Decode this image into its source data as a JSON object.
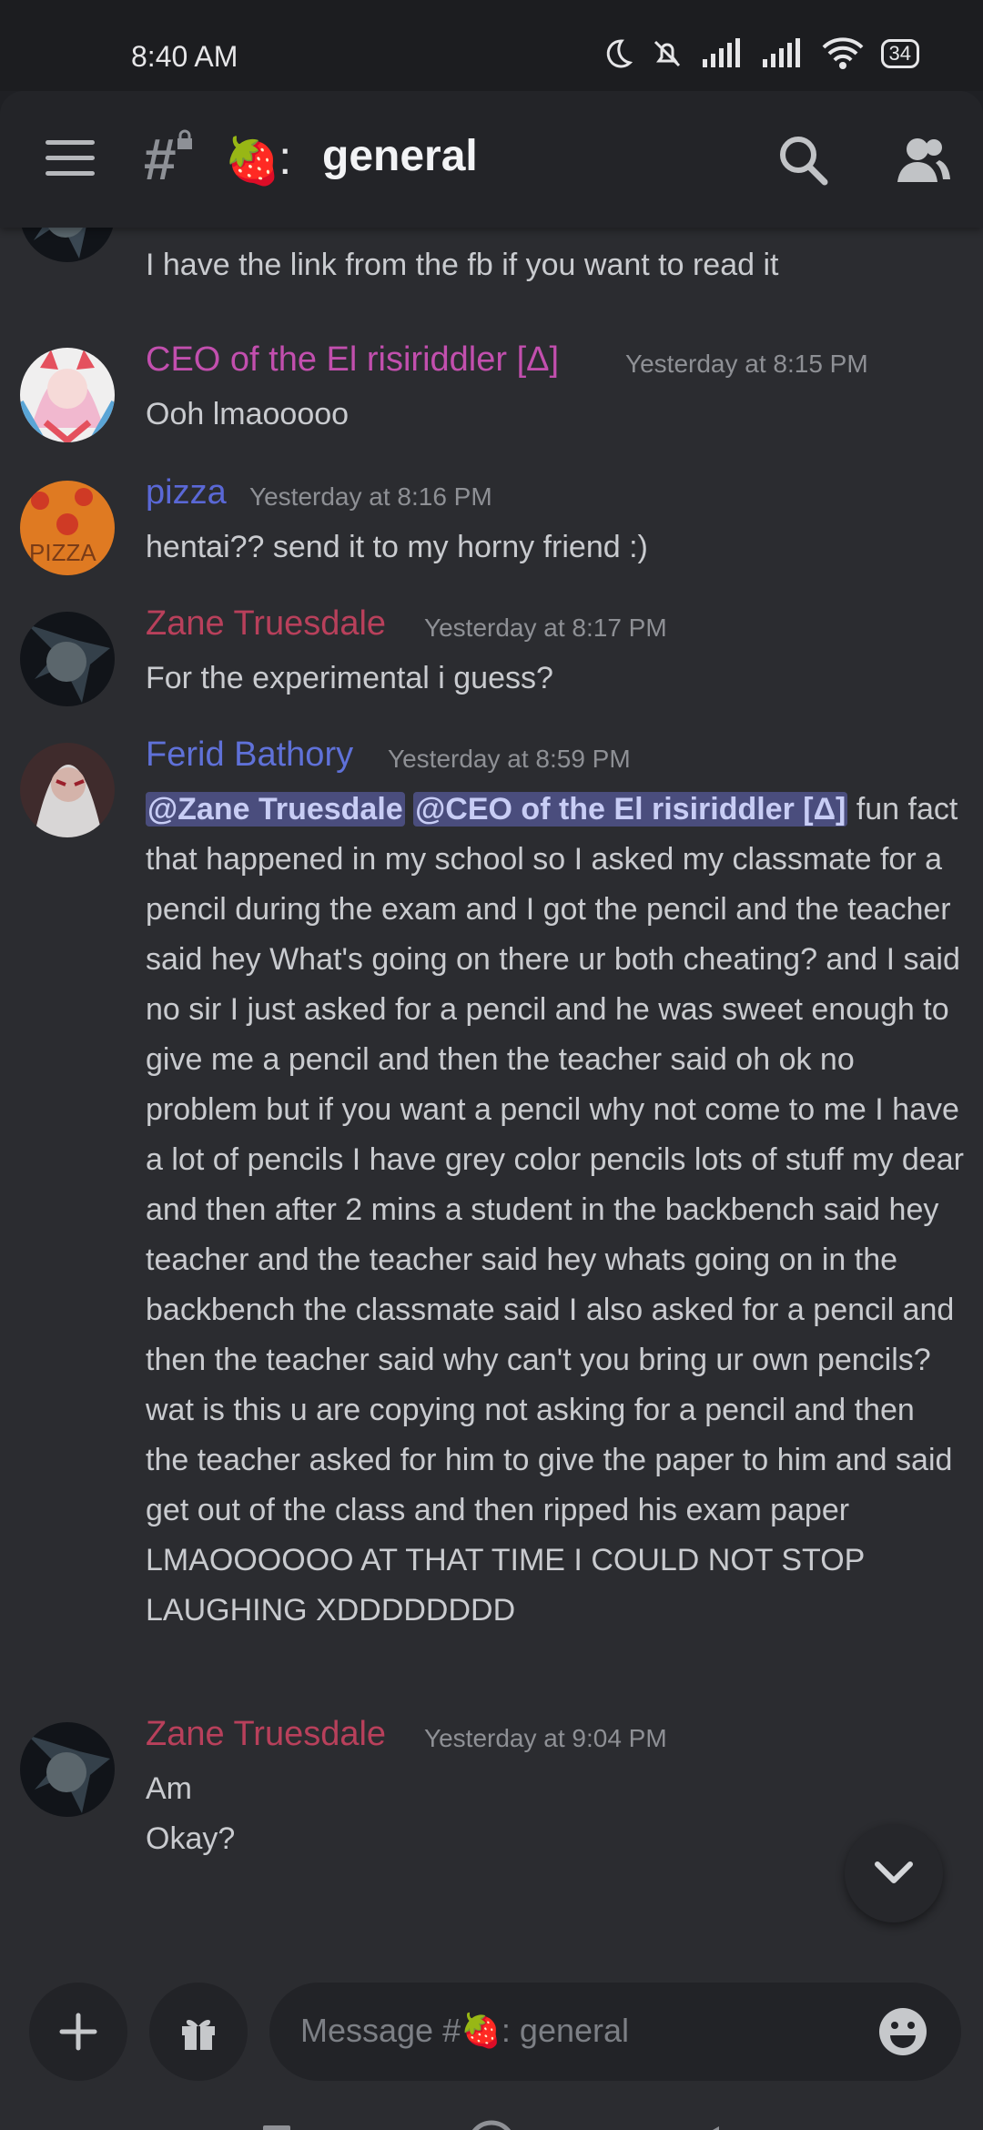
{
  "status_bar": {
    "time": "8:40 AM",
    "battery": "34",
    "icons": [
      "moon-icon",
      "bell-off-icon",
      "signal-icon",
      "signal-icon",
      "wifi-icon",
      "battery-icon"
    ]
  },
  "header": {
    "channel_symbol": "#",
    "channel_emoji": "🍓",
    "channel_separator": ":",
    "channel_name": "general",
    "icons": [
      "hamburger-icon",
      "locked-channel-icon",
      "search-icon",
      "members-icon"
    ]
  },
  "messages": [
    {
      "username": "",
      "timestamp": "",
      "text": "I have the link from the fb if you want to read it",
      "name_color": "#c75b72"
    },
    {
      "username": "CEO of the El risiriddler [Δ]",
      "timestamp": "Yesterday at 8:15 PM",
      "text": "Ooh lmaooooo",
      "name_color": "#c24fae"
    },
    {
      "username": "pizza",
      "timestamp": "Yesterday at 8:16 PM",
      "text": "hentai?? send it to my horny friend :)",
      "name_color": "#5a68d6"
    },
    {
      "username": "Zane Truesdale",
      "timestamp": "Yesterday at 8:17 PM",
      "text": "For the experimental i guess?",
      "name_color": "#b8405b"
    },
    {
      "username": "Ferid Bathory",
      "timestamp": "Yesterday at 8:59 PM",
      "mentions": [
        "@Zane Truesdale",
        "@CEO of the El risiriddler [Δ]"
      ],
      "text": "fun fact that happened in my school so I asked my classmate for a pencil during the exam and I got the pencil and the teacher said hey What's going on there ur both cheating? and I said no sir I just asked for a pencil and he was sweet enough to give me a pencil and then the teacher said oh ok no problem but if you want a pencil why not come to me I have a lot of pencils I have grey color pencils lots of stuff my dear and then after 2 mins a student in the backbench said hey teacher  and the teacher said hey whats going on in the backbench the classmate said I also asked for a pencil and then the teacher said why can't you bring ur own pencils? wat is this u are copying not asking for a pencil and then the teacher asked for him to give the paper to him and said get out of the class and then ripped his exam paper LMAOOOOOO  AT THAT TIME I COULD NOT STOP LAUGHING XDDDDDDDD",
      "name_color": "#5f71d8"
    },
    {
      "username": "Zane Truesdale",
      "timestamp": "Yesterday at 9:04 PM",
      "text_lines": [
        "Am",
        "Okay?"
      ],
      "name_color": "#b8405b"
    }
  ],
  "composer": {
    "placeholder": "Message #🍓:  general",
    "icons": [
      "plus-icon",
      "gift-icon",
      "emoji-icon"
    ]
  },
  "scroll_button_icon": "chevron-down-icon",
  "navigation": {
    "icons": [
      "recent-apps-icon",
      "home-icon",
      "back-icon"
    ]
  }
}
